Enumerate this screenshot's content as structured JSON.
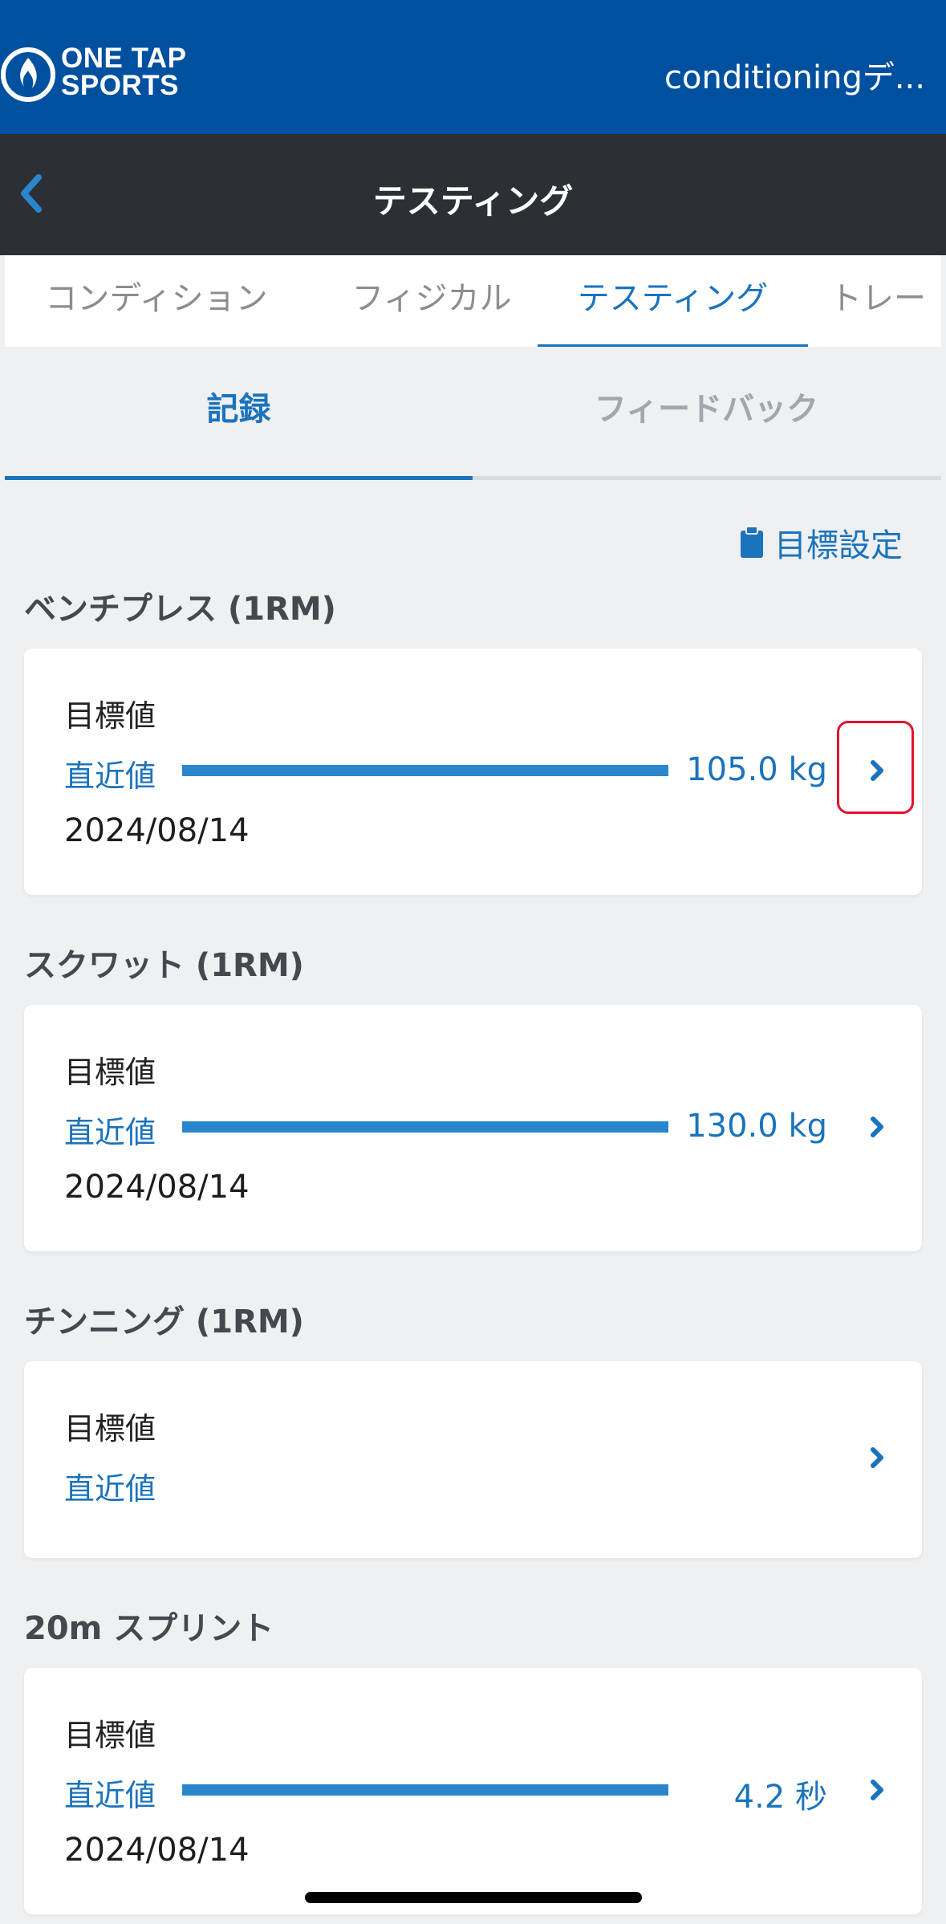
{
  "header": {
    "logo_lines": [
      "ONE TAP",
      "SPORTS"
    ],
    "account_name": "conditioningデ..."
  },
  "navbar": {
    "title": "テスティング"
  },
  "main_tabs": [
    {
      "label": "コンディション"
    },
    {
      "label": "フィジカル"
    },
    {
      "label": "テスティング",
      "active": true
    },
    {
      "label": "トレー"
    }
  ],
  "sub_tabs": [
    {
      "label": "記録",
      "active": true
    },
    {
      "label": "フィードバック"
    }
  ],
  "goal_setting_label": "目標設定",
  "sections": [
    {
      "title": "ベンチプレス (1RM)",
      "target_label": "目標値",
      "recent_label": "直近値",
      "value": "105.0 kg",
      "date": "2024/08/14",
      "progress": 1.0
    },
    {
      "title": "スクワット (1RM)",
      "target_label": "目標値",
      "recent_label": "直近値",
      "value": "130.0 kg",
      "date": "2024/08/14",
      "progress": 1.0
    },
    {
      "title": "チンニング (1RM)",
      "target_label": "目標値",
      "recent_label": "直近値"
    },
    {
      "title": "20m スプリント",
      "target_label": "目標値",
      "recent_label": "直近値",
      "value": "4.2 秒",
      "date": "2024/08/14",
      "progress": 1.0
    }
  ],
  "colors": {
    "brand_blue": "#0050a0",
    "navbar_dark": "#2c2f33",
    "accent_blue": "#1b73bc",
    "bar_blue": "#2a86cc",
    "highlight_red": "#e3122c"
  }
}
